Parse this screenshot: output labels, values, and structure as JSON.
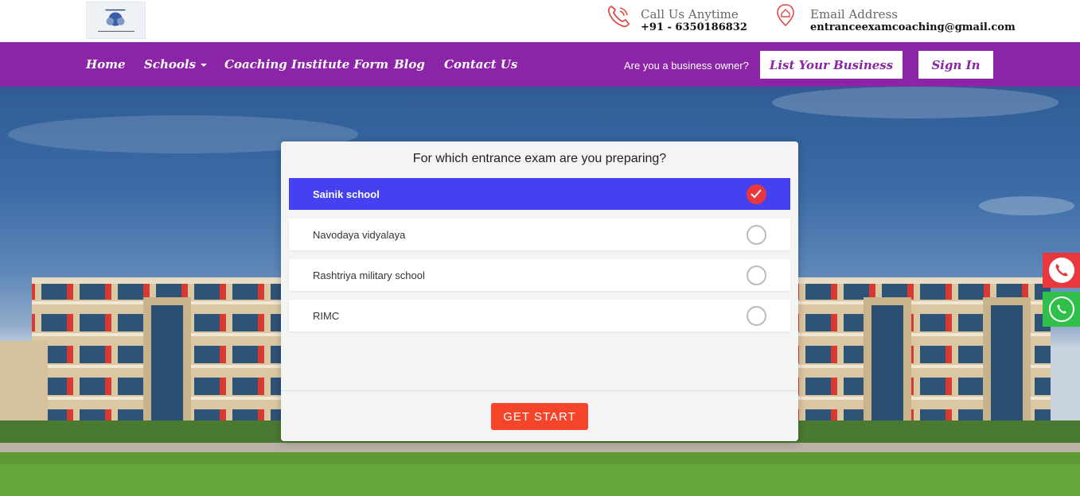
{
  "header": {
    "phone": {
      "label": "Call Us Anytime",
      "value": "+91 - 6350186832",
      "icon": "phone-icon"
    },
    "email": {
      "label": "Email Address",
      "value": "entranceexamcoaching@gmail.com",
      "icon": "location-pin-icon"
    }
  },
  "nav": {
    "items": [
      {
        "label": "Home"
      },
      {
        "label": "Schools",
        "has_dropdown": true
      },
      {
        "label": "Coaching Institute Form"
      },
      {
        "label": "Blog"
      },
      {
        "label": "Contact Us"
      }
    ],
    "business_question": "Are you a business owner?",
    "list_business_label": "List Your Business",
    "sign_in_label": "Sign In"
  },
  "quiz": {
    "question": "For which entrance exam are you preparing?",
    "options": [
      {
        "label": "Sainik school",
        "selected": true
      },
      {
        "label": "Navodaya vidyalaya",
        "selected": false
      },
      {
        "label": "Rashtriya military school",
        "selected": false
      },
      {
        "label": "RIMC",
        "selected": false
      }
    ],
    "start_label": "GET START"
  },
  "floating": {
    "call_icon": "phone-icon",
    "whatsapp_icon": "whatsapp-icon"
  },
  "colors": {
    "nav_bg": "#8c24a8",
    "selected_option": "#4641f0",
    "check": "#e8383d",
    "start_button": "#f4442a",
    "whatsapp": "#2fbf4a",
    "call": "#e8383d"
  }
}
